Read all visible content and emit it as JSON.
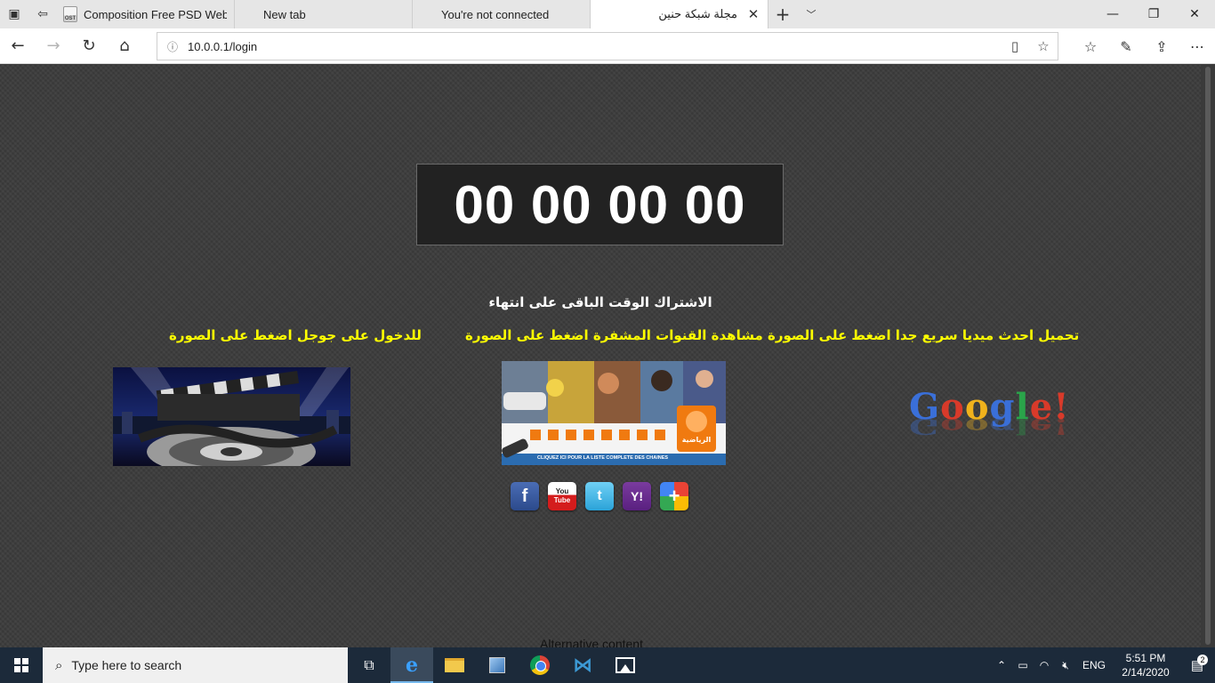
{
  "tabs": [
    {
      "title": "Composition Free PSD Web",
      "favicon": "ost-icon"
    },
    {
      "title": "New tab",
      "favicon": "page-icon"
    },
    {
      "title": "You're not connected",
      "favicon": "page-icon"
    },
    {
      "title": "مجلة شبكة حنين",
      "favicon": "page-icon",
      "active": true
    }
  ],
  "address": {
    "url": "10.0.0.1/login"
  },
  "page": {
    "countdown": "00 00 00 00",
    "subscription_message": "الاشتراك الوقت الباقى على انتهاء",
    "link_google": "للدخول على جوجل اضغط على الصورة",
    "link_media": "تحميل احدث ميديا سريع جدا اضغط على الصورة مشاهدة القنوات المشفرة اضغط على الصورة",
    "google_logo_text": "Google!",
    "sports_banner_caption": "CLIQUEZ ICI POUR LA LISTE COMPLÈTE DES CHAÎNES",
    "sports_banner_brand": "الرياضية",
    "social": {
      "youtube_you": "You",
      "youtube_tube": "Tube",
      "facebook": "f",
      "twitter": "t",
      "yahoo": "Y!",
      "plus": "+"
    },
    "alt_content": "Alternative content"
  },
  "taskbar": {
    "search_placeholder": "Type here to search",
    "lang": "ENG",
    "time": "5:51 PM",
    "date": "2/14/2020",
    "notifications": "2"
  },
  "colors": {
    "page_bg": "#3c3c3c",
    "link_yellow": "#ffff00",
    "countdown_bg": "#222222",
    "taskbar_bg": "#1c2a3a"
  }
}
